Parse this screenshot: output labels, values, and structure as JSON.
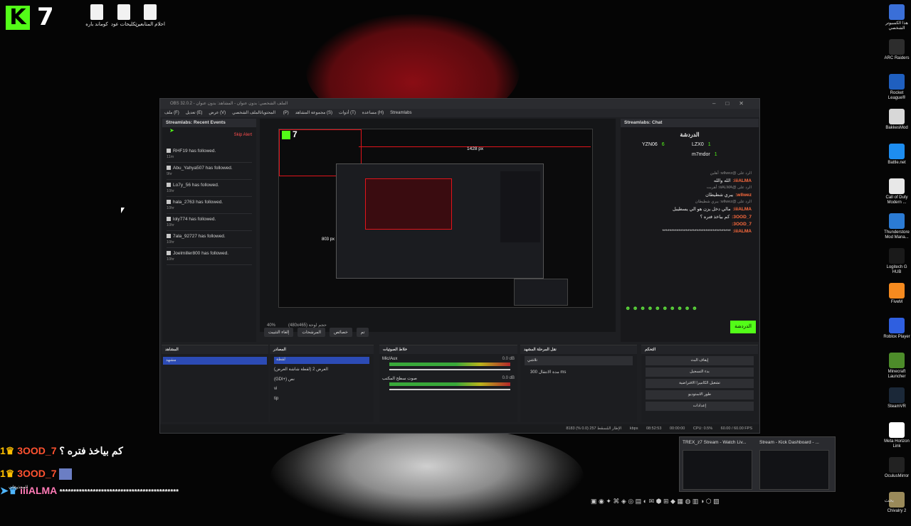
{
  "desktop": {
    "brand_k": "K",
    "brand_7": "7",
    "icons_top": [
      {
        "label": "كوماند باره"
      },
      {
        "label": "تكليحات عود"
      },
      {
        "label": "احلام المتابعين"
      }
    ],
    "icons_right": [
      {
        "label": "هذا الكمبيوتر الشخصي",
        "color": "#3a6fd8"
      },
      {
        "label": "ARC Raiders",
        "color": "#2d2d2d"
      },
      {
        "label": "Rocket League®",
        "color": "#1f5fbf"
      },
      {
        "label": "BakkesMod",
        "color": "#d8d8d8"
      },
      {
        "label": "Battle.net",
        "color": "#1d8df0"
      },
      {
        "label": "Call of Duty Modern ...",
        "color": "#e8e8e8"
      },
      {
        "label": "Thunderstore Mod Mana...",
        "color": "#2b7bd4"
      },
      {
        "label": "Logitech G HUB",
        "color": "#1a1a1a"
      },
      {
        "label": "FiveM",
        "color": "#f58a1f"
      },
      {
        "label": "Roblox Player",
        "color": "#2f5fe0"
      },
      {
        "label": "Minecraft Launcher",
        "color": "#4d8c2a"
      },
      {
        "label": "SteamVR",
        "color": "#1b2838"
      },
      {
        "label": "Meta Horizon Link",
        "color": "#ffffff"
      },
      {
        "label": "OculusMirror",
        "color": "#222222"
      },
      {
        "label": "Chivalry 2",
        "color": "#9a8a5a"
      }
    ]
  },
  "obs": {
    "title": "OBS 32.0.2 - الملف الشخصي: بدون عنوان - المشاهد: بدون عنوان",
    "menu": [
      "ملف (F)",
      "تعديل (E)",
      "عرض (V)",
      "المحتويات",
      "الملف الشخصي (P)",
      "مجموعة المشاهد (S)",
      "أدوات (T)",
      "مساعدة (H)",
      "Streamlabs"
    ],
    "events_panel": {
      "title": "Streamlabs: Recent Events",
      "skip": "Skip Alert",
      "events": [
        {
          "name": "RHF19 has followed.",
          "time": "11m"
        },
        {
          "name": "Abu_Yahya507 has followed.",
          "time": "9hr"
        },
        {
          "name": "Lo7y_56 has followed.",
          "time": "10hr"
        },
        {
          "name": "hala_2763 has followed.",
          "time": "10hr"
        },
        {
          "name": "loly774 has followed.",
          "time": "10hr"
        },
        {
          "name": "7ala_92727 has followed.",
          "time": "10hr"
        },
        {
          "name": "Joelmiller800 has followed.",
          "time": "10hr"
        }
      ]
    },
    "preview": {
      "width_label": "1428 px",
      "height_label": "803 px",
      "zoom": "40%",
      "resolution_note": "(480x465) حجم لوحة",
      "brand": "7"
    },
    "controls_row": [
      "إلغاء التثبيت",
      "المرشحات",
      "خصائص",
      "تم"
    ],
    "chat_panel": {
      "title": "Streamlabs: Chat",
      "heading": "الدردشة",
      "leaders": [
        {
          "name": "YZN06",
          "count": "6"
        },
        {
          "name": "LZX0",
          "count": "1"
        },
        {
          "name": "m7mdor",
          "count": "1"
        }
      ],
      "messages": [
        {
          "reply": "الرد على @wllwez: أهلين",
          "user": "iiiALMA:",
          "text": "الله والله"
        },
        {
          "reply": "الرد على @iiiALMA: أهربت",
          "user": "wllwez:",
          "text": "يبري شطيطان"
        },
        {
          "reply": "الرد على @wllwez: يبري شطيطان",
          "user": "iiiALMA:",
          "text": "مالي دخل يزن هو الي يسطيبل"
        },
        {
          "reply": "",
          "user": "3OOD_7:",
          "text": "كم بياخذ فتره ؟"
        },
        {
          "reply": "",
          "user": "3OOD_7:",
          "text": ""
        },
        {
          "reply": "",
          "user": "iiiALMA:",
          "text": "**************************************"
        }
      ],
      "send": "الدردشة"
    },
    "docks": {
      "scenes_title": "المشاهد",
      "scene_selected": "مشهد",
      "sources_title": "المصادر",
      "sources": [
        "لقطة",
        "العرض 2 (لقطة شاشة العرض)",
        "(GDI+) نص",
        "vi",
        "tip"
      ],
      "mixer_title": "خلاط الصوتيات",
      "mixer": [
        {
          "name": "Mic/Aux",
          "db": "0.0 dB"
        },
        {
          "name": "صوت سطح المكتب",
          "db": "0.0 dB"
        }
      ],
      "transitions_title": "نقل المرحلة المشهد",
      "transition_type": "تلاشي",
      "duration_label": "مدة الانتقال",
      "duration": "300 ms",
      "controls_title": "التحكم",
      "controls": [
        "إيقاف البث",
        "بدء التسجيل",
        "تشغيل الكاميرا الافتراضية",
        "طور الاستوديو",
        "إعدادات"
      ]
    },
    "status": {
      "dropped": "الإطار المُسقَط 257 (0.0 %)",
      "kbps": "8183 kbps",
      "stream_time": "08:52:53",
      "rec_time": "00:00:00",
      "cpu": "CPU: 0.5%",
      "fps": "60.00 / 60.00 FPS"
    }
  },
  "overlay_chat": [
    {
      "name": "3OOD_7",
      "text": "كم بياخذ فتره ؟"
    },
    {
      "name": "3OOD_7",
      "text": ""
    },
    {
      "name": "iiiALMA",
      "text": "*******************************************"
    }
  ],
  "overlay_small": "المحذوفات",
  "taskbar_previews": [
    {
      "title": "TREX_z7 Stream - Watch Liv..."
    },
    {
      "title": "Stream - Kick Dashboard - ..."
    }
  ],
  "search_label": "بحث"
}
